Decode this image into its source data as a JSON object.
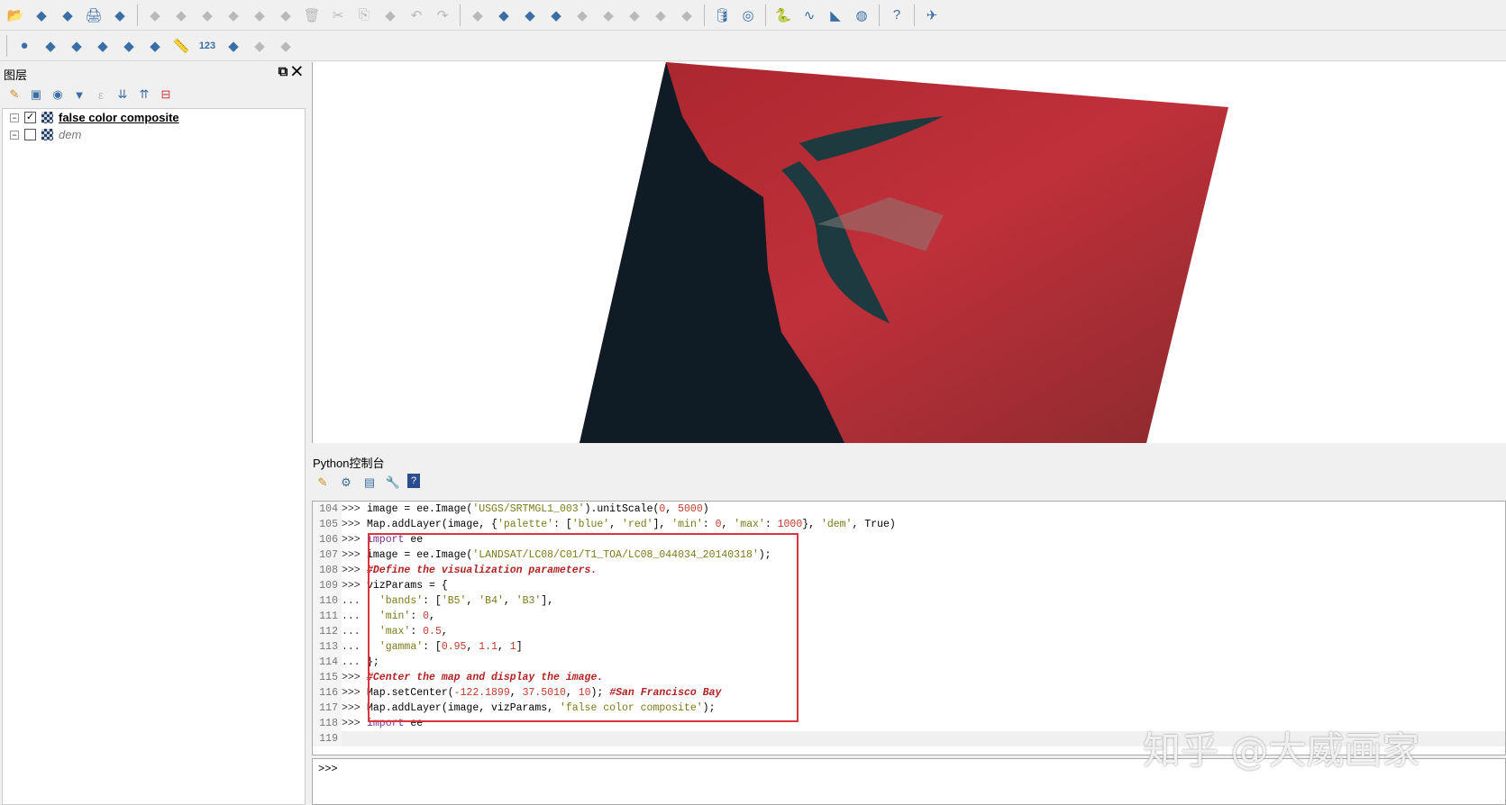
{
  "toolbar1": {
    "icons": [
      "open-project-icon",
      "new-vector-icon",
      "digitize-icon",
      "print-icon",
      "vector-icon",
      "edit-icon",
      "pencil-icon",
      "save-edits-icon",
      "node-tool-icon",
      "move-feature-icon",
      "attribute-icon",
      "delete-icon",
      "cut-icon",
      "copy-icon",
      "paste-icon",
      "undo-icon",
      "redo-icon",
      "label-icon",
      "label-pin-icon",
      "label-abc-icon",
      "label-abc-red-icon",
      "label-move-icon",
      "label-show-icon",
      "label-rotate-icon",
      "label-change-icon",
      "label-tool-icon",
      "database-icon",
      "globe-plugin-icon",
      "python-icon",
      "curve-icon",
      "ruler-arrow-icon",
      "earth-icon",
      "help-icon",
      "satellite-icon"
    ]
  },
  "toolbar2": {
    "icons": [
      "circle-icon",
      "xy-icon",
      "curve-tool-icon",
      "line-tool-icon",
      "snapping-icon",
      "trace-icon",
      "measure-icon",
      "label-123",
      "shape-tool-icon",
      "split-icon",
      "merge-icon"
    ],
    "label_123": "123"
  },
  "layers_panel": {
    "title": "图层",
    "layers": [
      {
        "name": "false color composite",
        "checked": true
      },
      {
        "name": "dem",
        "checked": false
      }
    ]
  },
  "python_console": {
    "title": "Python控制台",
    "prompt": ">>>",
    "lines": [
      {
        "n": "104",
        "p": ">>>",
        "html": "image = ee.Image(<span class=s>'USGS/SRTMGL1_003'</span>).unitScale(<span class=n>0</span>, <span class=n>5000</span>)"
      },
      {
        "n": "105",
        "p": ">>>",
        "html": "Map.addLayer(image, {<span class=s>'palette'</span>: [<span class=s>'blue'</span>, <span class=s>'red'</span>], <span class=s>'min'</span>: <span class=n>0</span>, <span class=s>'max'</span>: <span class=n>1000</span>}, <span class=s>'dem'</span>, True)"
      },
      {
        "n": "106",
        "p": ">>>",
        "html": "<span class=k>import</span> ee"
      },
      {
        "n": "107",
        "p": ">>>",
        "html": "image = ee.Image(<span class=s>'LANDSAT/LC08/C01/T1_TOA/LC08_044034_20140318'</span>);"
      },
      {
        "n": "108",
        "p": ">>>",
        "html": "<span class=c>#Define the visualization parameters.</span>"
      },
      {
        "n": "109",
        "p": ">>>",
        "html": "vizParams = {"
      },
      {
        "n": "110",
        "p": "...",
        "html": "  <span class=s>'bands'</span>: [<span class=s>'B5'</span>, <span class=s>'B4'</span>, <span class=s>'B3'</span>],"
      },
      {
        "n": "111",
        "p": "...",
        "html": "  <span class=s>'min'</span>: <span class=n>0</span>,"
      },
      {
        "n": "112",
        "p": "...",
        "html": "  <span class=s>'max'</span>: <span class=n>0.5</span>,"
      },
      {
        "n": "113",
        "p": "...",
        "html": "  <span class=s>'gamma'</span>: [<span class=n>0.95</span>, <span class=n>1.1</span>, <span class=n>1</span>]"
      },
      {
        "n": "114",
        "p": "...",
        "html": "};"
      },
      {
        "n": "115",
        "p": ">>>",
        "html": "<span class=c>#Center the map and display the image.</span>"
      },
      {
        "n": "116",
        "p": ">>>",
        "html": "Map.setCenter(<span class=n>-122.1899</span>, <span class=n>37.5010</span>, <span class=n>10</span>); <span class=c>#San Francisco Bay</span>"
      },
      {
        "n": "117",
        "p": ">>>",
        "html": "Map.addLayer(image, vizParams, <span class=s>'false color composite'</span>);"
      },
      {
        "n": "118",
        "p": ">>>",
        "html": "<span class=k>import</span> ee"
      },
      {
        "n": "119",
        "p": "",
        "html": ""
      }
    ]
  },
  "watermark": "知乎 @大威画家"
}
